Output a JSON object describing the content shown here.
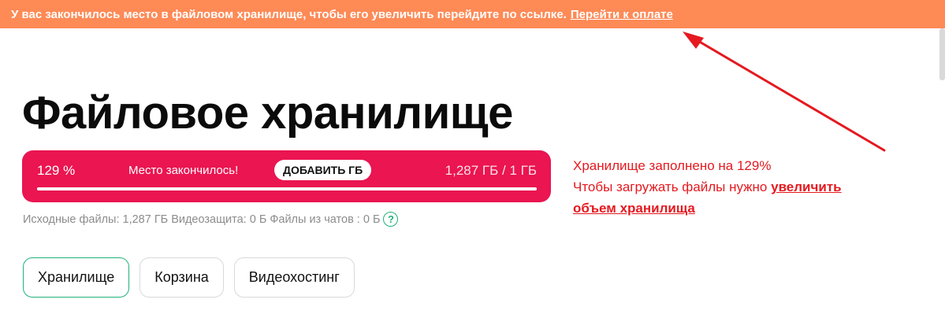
{
  "banner": {
    "message": "У вас закончилось место в файловом хранилище, чтобы его увеличить перейдите по ссылке.",
    "link_label": "Перейти к оплате"
  },
  "page": {
    "title": "Файловое хранилище"
  },
  "storage": {
    "percent_label": "129 %",
    "used_fraction": 1.0,
    "message": "Место закончилось!",
    "add_button_label": "ДОБАВИТЬ ГБ",
    "usage_label": "1,287 ГБ / 1 ГБ"
  },
  "breakdown": {
    "source_files": "Исходные файлы: 1,287 ГБ",
    "video_protection": "Видеозащита: 0 Б",
    "chat_files": "Файлы из чатов : 0 Б",
    "help_icon": "?"
  },
  "tabs": [
    {
      "label": "Хранилище",
      "active": true
    },
    {
      "label": "Корзина",
      "active": false
    },
    {
      "label": "Видеохостинг",
      "active": false
    }
  ],
  "annotation": {
    "line1": "Хранилище заполнено на 129%",
    "line2_text": "Чтобы загружать файлы нужно",
    "line2_link": "увеличить",
    "line3_link": "объем хранилища"
  },
  "colors": {
    "banner_bg": "#fe8a56",
    "storage_bar_bg": "#ea1551",
    "accent_green": "#1fb27a",
    "annotation_red": "#e5191f"
  }
}
